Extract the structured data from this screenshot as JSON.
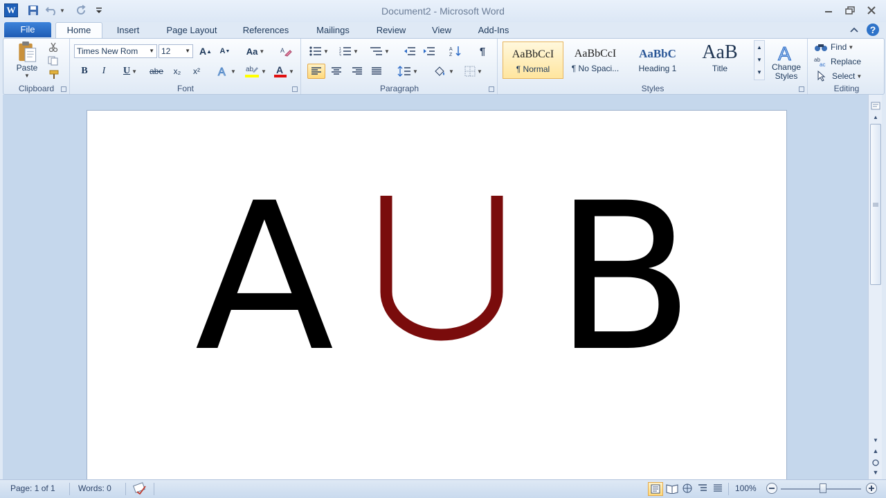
{
  "window": {
    "title": "Document2  -  Microsoft Word",
    "app_icon_letter": "W"
  },
  "tabs": {
    "file": "File",
    "items": [
      "Home",
      "Insert",
      "Page Layout",
      "References",
      "Mailings",
      "Review",
      "View",
      "Add-Ins"
    ]
  },
  "ribbon": {
    "clipboard": {
      "label": "Clipboard",
      "paste": "Paste"
    },
    "font": {
      "label": "Font",
      "name": "Times New Rom",
      "size": "12",
      "bold": "B",
      "italic": "I",
      "underline": "U",
      "strike": "abe",
      "subscript": "x₂",
      "superscript": "x²",
      "grow": "A",
      "shrink": "A",
      "case": "Aa",
      "highlight_color": "#ffff00",
      "font_color": "#e01010"
    },
    "paragraph": {
      "label": "Paragraph",
      "pilcrow": "¶"
    },
    "styles": {
      "label": "Styles",
      "items": [
        {
          "sample": "AaBbCcI",
          "name": "¶ Normal"
        },
        {
          "sample": "AaBbCcI",
          "name": "¶ No Spaci..."
        },
        {
          "sample": "AaBbC",
          "name": "Heading 1"
        },
        {
          "sample": "AaB",
          "name": "Title"
        }
      ],
      "change_styles": "Change Styles"
    },
    "editing": {
      "label": "Editing",
      "find": "Find",
      "replace": "Replace",
      "select": "Select"
    }
  },
  "document": {
    "letters": [
      "A",
      "B"
    ],
    "union_color": "#7a0c0c"
  },
  "statusbar": {
    "page": "Page: 1 of 1",
    "words": "Words: 0",
    "zoom": "100%"
  }
}
